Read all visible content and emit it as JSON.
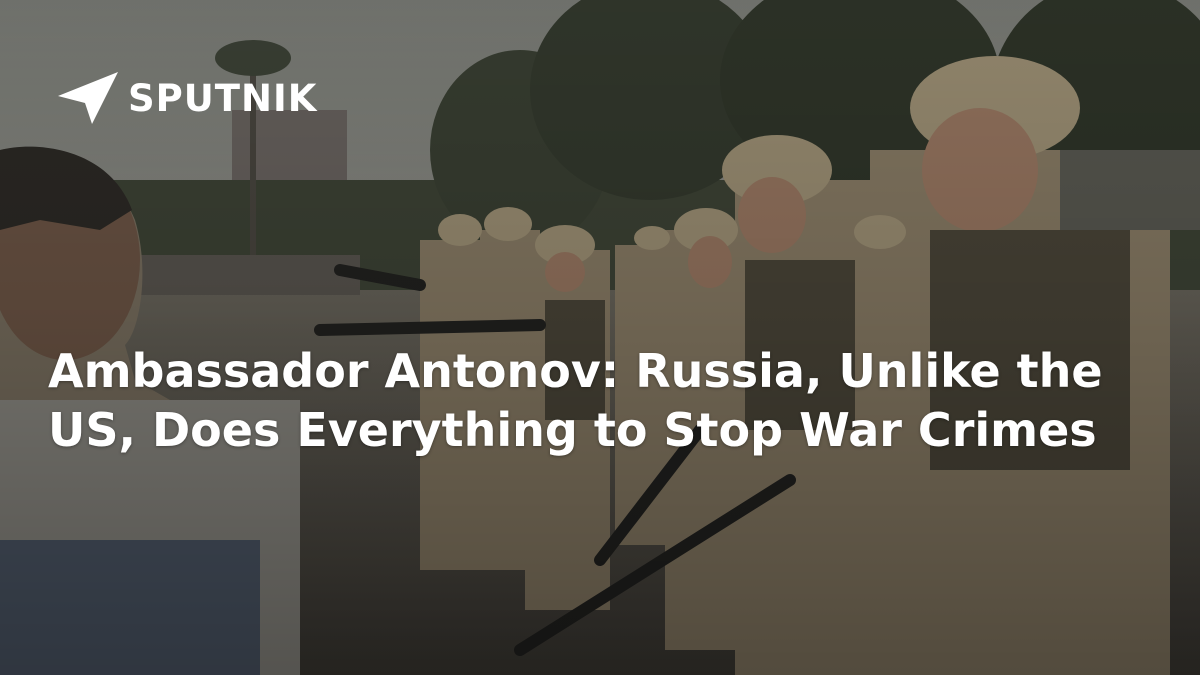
{
  "brand": {
    "logo_text": "SPUTNIK"
  },
  "headline": "Ambassador Antonov: Russia, Unlike the US, Does Everything to Stop War Crimes",
  "colors": {
    "headline_text": "#ffffff",
    "logo": "#ffffff"
  },
  "icons": {
    "logo_mark": "sputnik-arrow-icon"
  }
}
